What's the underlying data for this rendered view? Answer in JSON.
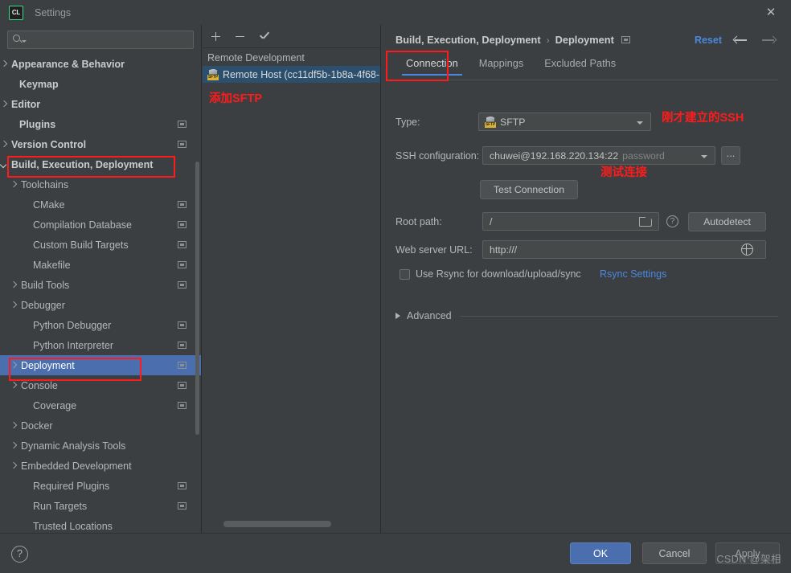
{
  "window": {
    "title": "Settings",
    "logo_text": "CL",
    "close_icon": "close-icon"
  },
  "sidebar": {
    "search_value": "",
    "search_placeholder": "",
    "items": [
      {
        "label": "Appearance & Behavior",
        "arrow": "right",
        "bold": true,
        "indent": 10,
        "badge": false
      },
      {
        "label": "Keymap",
        "arrow": "none",
        "bold": true,
        "indent": 24,
        "badge": false
      },
      {
        "label": "Editor",
        "arrow": "right",
        "bold": true,
        "indent": 10,
        "badge": false
      },
      {
        "label": "Plugins",
        "arrow": "none",
        "bold": true,
        "indent": 24,
        "badge": true
      },
      {
        "label": "Version Control",
        "arrow": "right",
        "bold": true,
        "indent": 10,
        "badge": true
      },
      {
        "label": "Build, Execution, Deployment",
        "arrow": "down",
        "bold": true,
        "indent": 10,
        "badge": false
      },
      {
        "label": "Toolchains",
        "arrow": "right",
        "bold": false,
        "indent": 26,
        "badge": false
      },
      {
        "label": "CMake",
        "arrow": "none",
        "bold": false,
        "indent": 41,
        "badge": true
      },
      {
        "label": "Compilation Database",
        "arrow": "none",
        "bold": false,
        "indent": 41,
        "badge": true
      },
      {
        "label": "Custom Build Targets",
        "arrow": "none",
        "bold": false,
        "indent": 41,
        "badge": true
      },
      {
        "label": "Makefile",
        "arrow": "none",
        "bold": false,
        "indent": 41,
        "badge": true
      },
      {
        "label": "Build Tools",
        "arrow": "right",
        "bold": false,
        "indent": 26,
        "badge": true
      },
      {
        "label": "Debugger",
        "arrow": "right",
        "bold": false,
        "indent": 26,
        "badge": false
      },
      {
        "label": "Python Debugger",
        "arrow": "none",
        "bold": false,
        "indent": 41,
        "badge": true
      },
      {
        "label": "Python Interpreter",
        "arrow": "none",
        "bold": false,
        "indent": 41,
        "badge": true
      },
      {
        "label": "Deployment",
        "arrow": "right",
        "bold": false,
        "indent": 26,
        "badge": true,
        "selected": true
      },
      {
        "label": "Console",
        "arrow": "right",
        "bold": false,
        "indent": 26,
        "badge": true
      },
      {
        "label": "Coverage",
        "arrow": "none",
        "bold": false,
        "indent": 41,
        "badge": true
      },
      {
        "label": "Docker",
        "arrow": "right",
        "bold": false,
        "indent": 26,
        "badge": false
      },
      {
        "label": "Dynamic Analysis Tools",
        "arrow": "right",
        "bold": false,
        "indent": 26,
        "badge": false
      },
      {
        "label": "Embedded Development",
        "arrow": "right",
        "bold": false,
        "indent": 26,
        "badge": false
      },
      {
        "label": "Required Plugins",
        "arrow": "none",
        "bold": false,
        "indent": 41,
        "badge": true
      },
      {
        "label": "Run Targets",
        "arrow": "none",
        "bold": false,
        "indent": 41,
        "badge": true
      },
      {
        "label": "Trusted Locations",
        "arrow": "none",
        "bold": false,
        "indent": 41,
        "badge": false
      }
    ]
  },
  "middle_panel": {
    "toolbar": {
      "add_icon": "plus-icon",
      "remove_icon": "minus-icon",
      "default_icon": "check-icon"
    },
    "group_label": "Remote Development",
    "server_item": {
      "label": "Remote Host (cc11df5b-1b8a-4f68-",
      "icon": "sftp-icon",
      "icon_badge": "SFTP"
    },
    "annotation": "添加SFTP"
  },
  "right_panel": {
    "breadcrumb": {
      "parent": "Build, Execution, Deployment",
      "separator": "›",
      "current": "Deployment"
    },
    "reset_label": "Reset",
    "nav_back_icon": "arrow-left-icon",
    "nav_forward_icon": "arrow-right-icon",
    "tabs": [
      {
        "label": "Connection",
        "active": true
      },
      {
        "label": "Mappings",
        "active": false
      },
      {
        "label": "Excluded Paths",
        "active": false
      }
    ],
    "form": {
      "type_label": "Type:",
      "type_value": "SFTP",
      "type_icon": "sftp-icon",
      "ssh_label": "SSH configuration:",
      "ssh_value": "chuwei@192.168.220.134:22",
      "ssh_value_dim": "password",
      "ssh_browse_label": "...",
      "test_connection_label": "Test Connection",
      "root_path_label": "Root path:",
      "root_path_value": "/",
      "root_path_folder_icon": "folder-icon",
      "root_path_help_icon": "help-icon",
      "autodetect_label": "Autodetect",
      "web_url_label": "Web server URL:",
      "web_url_value": "http:///",
      "web_url_globe_icon": "globe-icon",
      "rsync_checkbox_checked": false,
      "rsync_label": "Use Rsync for download/upload/sync",
      "rsync_settings_link": "Rsync Settings",
      "advanced_label": "Advanced"
    },
    "annotations": {
      "ssh_note": "刚才建立的SSH",
      "test_note": "测试连接"
    }
  },
  "bottom_bar": {
    "help_icon": "question-mark-icon",
    "ok_label": "OK",
    "cancel_label": "Cancel",
    "apply_label": "Apply"
  },
  "watermark": "CSDN @架相",
  "colors": {
    "accent_blue": "#4a88dd",
    "selection_blue": "#4b6eaf",
    "annotation_red": "#ff1b1b",
    "panel_bg": "#3c3f41",
    "field_bg": "#45494a"
  }
}
